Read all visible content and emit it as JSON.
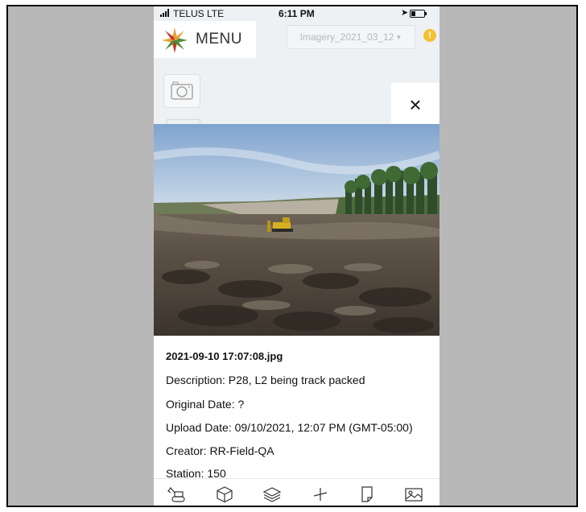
{
  "status_bar": {
    "carrier": "TELUS  LTE",
    "time": "6:11 PM"
  },
  "header": {
    "menu_label": "MENU",
    "imagery_selected": "Imagery_2021_03_12",
    "alert_badge": "!"
  },
  "viewer": {
    "close_icon": "close-icon",
    "close_glyph": "×"
  },
  "photo_info": {
    "file_name": "2021-09-10 17:07:08.jpg",
    "description": "Description: P28, L2 being track packed",
    "original_date": "Original Date: ?",
    "upload_date": "Upload Date: 09/10/2021, 12:07 PM (GMT-05:00)",
    "creator": "Creator: RR-Field-QA",
    "station": "Station: 150"
  },
  "toolbar": {
    "items": [
      {
        "icon": "excavator-icon"
      },
      {
        "icon": "box-icon"
      },
      {
        "icon": "layers-icon"
      },
      {
        "icon": "measure-icon"
      },
      {
        "icon": "note-icon"
      },
      {
        "icon": "image-icon"
      }
    ]
  },
  "colors": {
    "app_background": "#eef1f3",
    "frame_background": "#b8b8b8",
    "alert": "#f1c232",
    "text": "#111111",
    "muted_text": "#b5b8bb"
  }
}
